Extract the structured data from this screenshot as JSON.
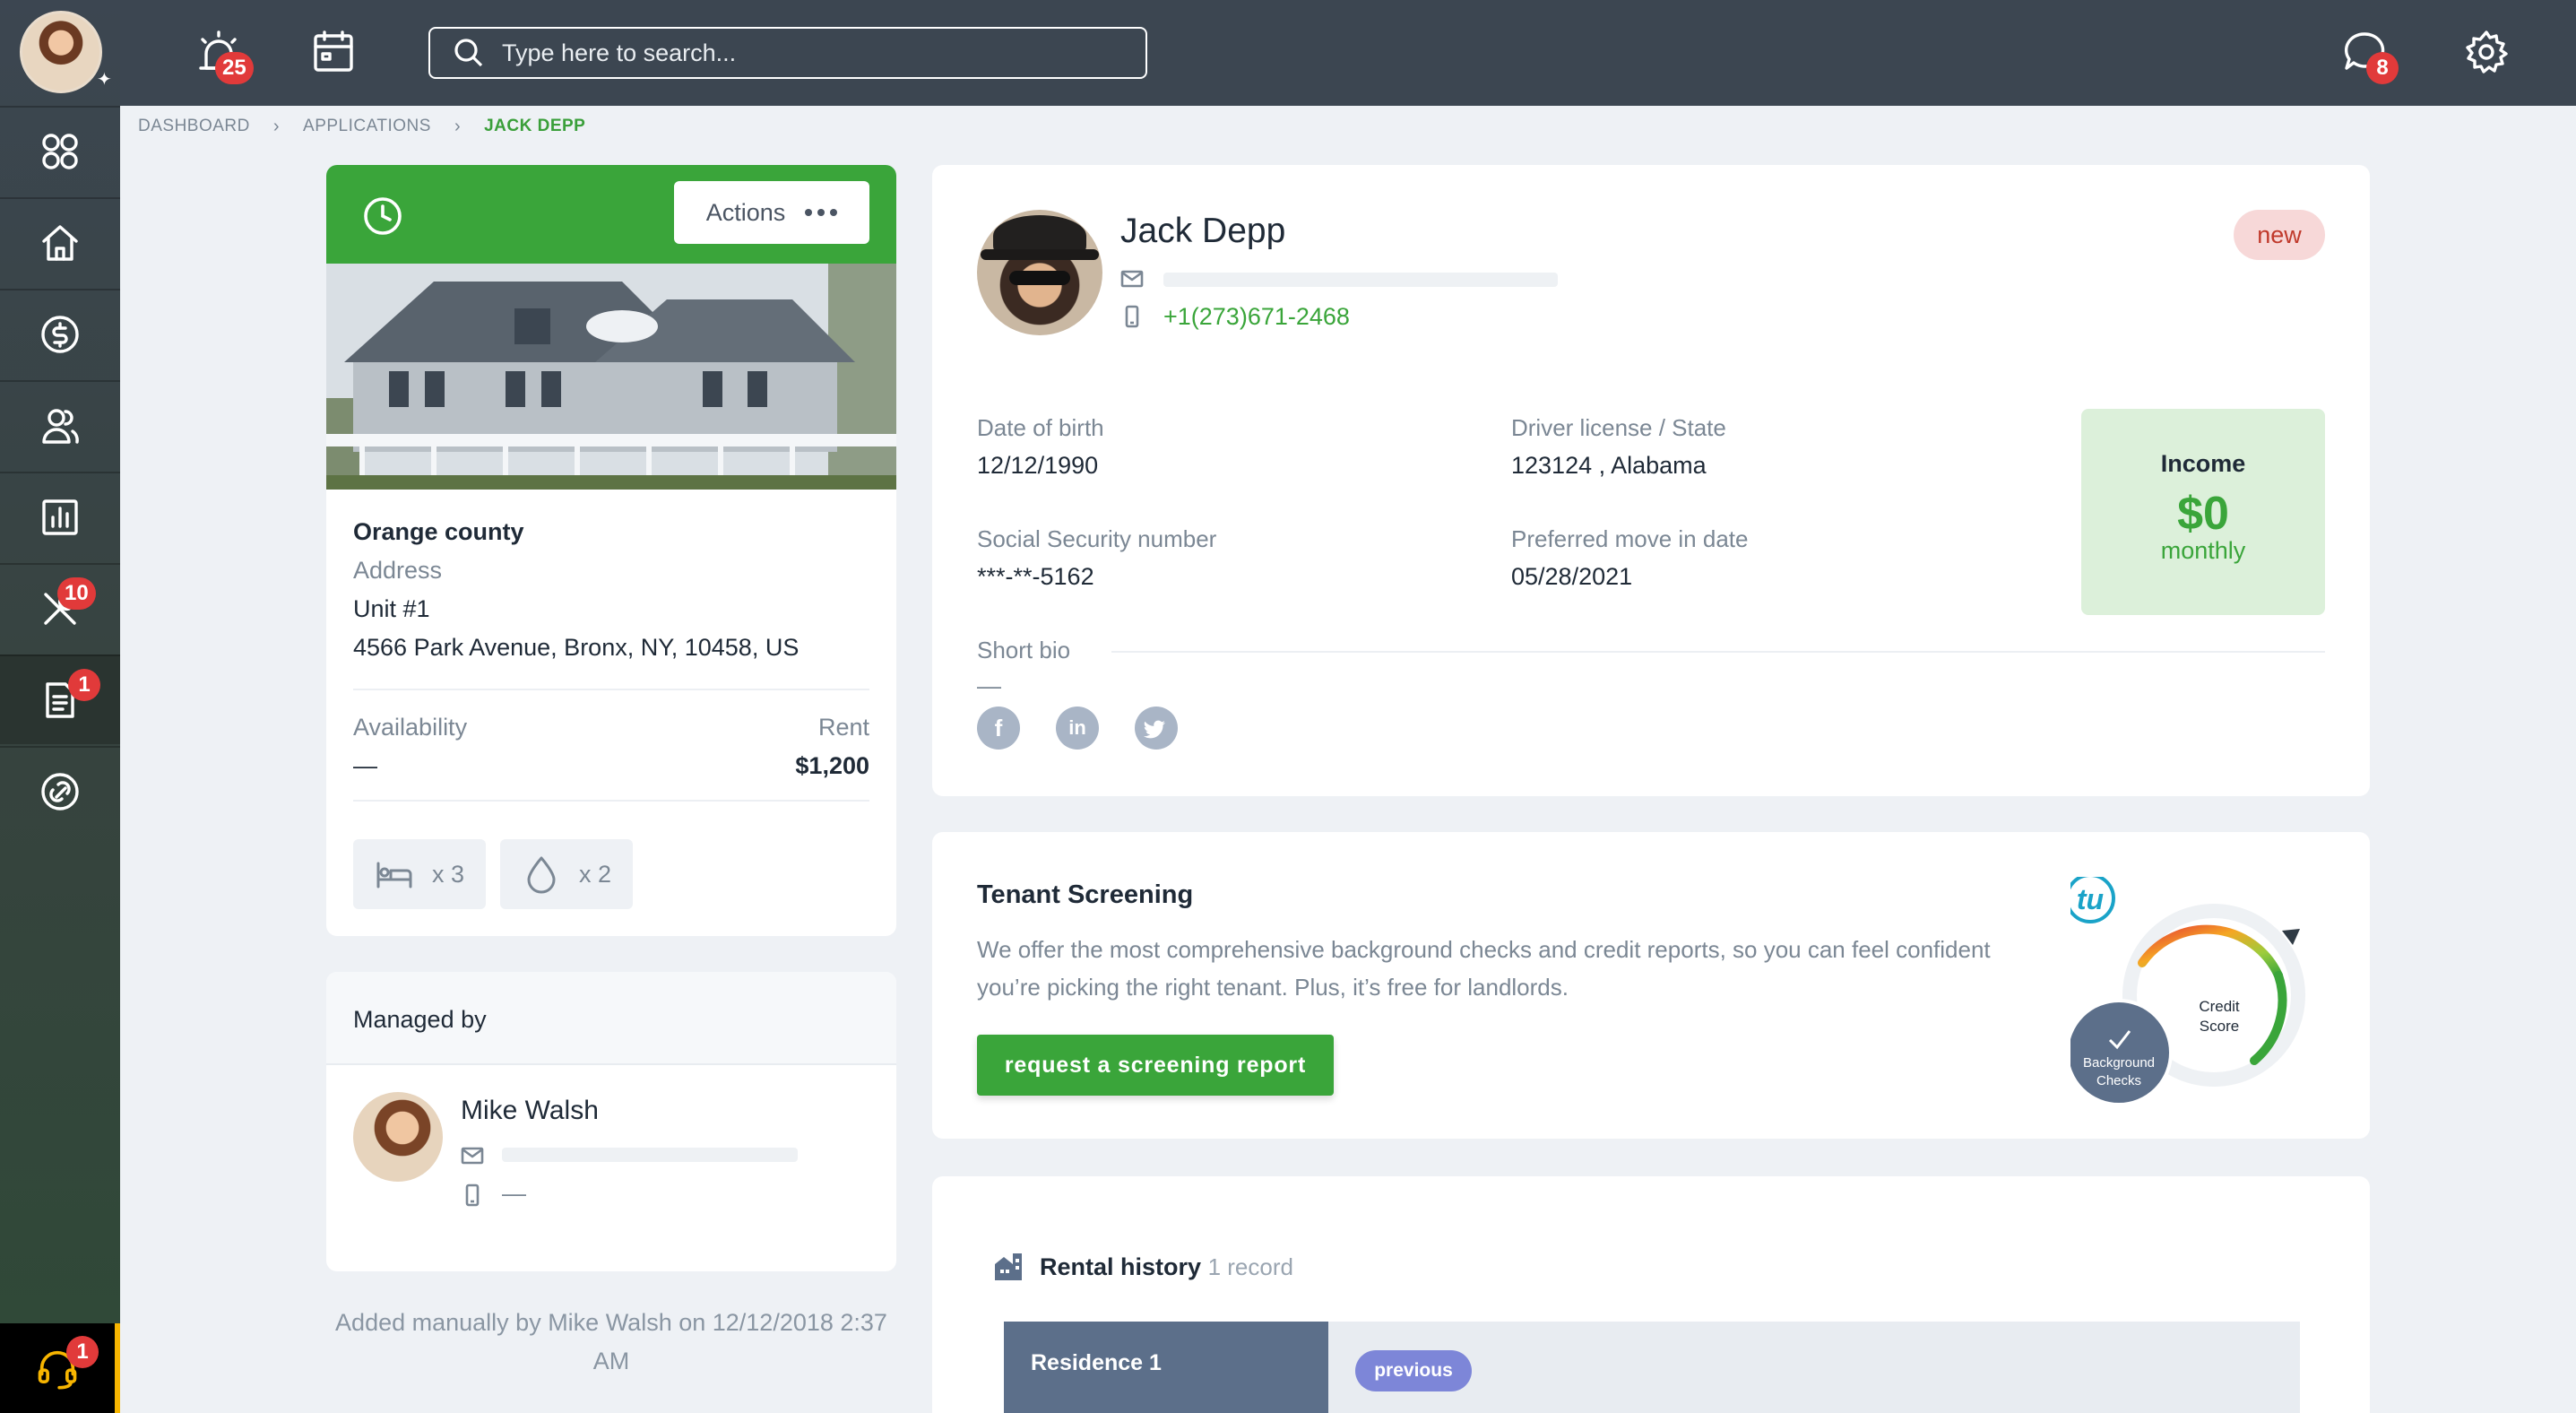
{
  "topbar": {
    "alarm_badge": "25",
    "search_placeholder": "Type here to search...",
    "chat_badge": "8"
  },
  "sidebar": {
    "items": [
      {
        "name": "apps",
        "icon": "grid-icon",
        "badge": ""
      },
      {
        "name": "home",
        "icon": "home-icon",
        "badge": ""
      },
      {
        "name": "payments",
        "icon": "dollar-icon",
        "badge": ""
      },
      {
        "name": "people",
        "icon": "users-icon",
        "badge": ""
      },
      {
        "name": "reports",
        "icon": "chart-icon",
        "badge": ""
      },
      {
        "name": "maintenance",
        "icon": "tools-icon",
        "badge": "10"
      },
      {
        "name": "applications",
        "icon": "document-icon",
        "badge": "1"
      },
      {
        "name": "links",
        "icon": "link-icon",
        "badge": ""
      }
    ],
    "support_badge": "1"
  },
  "breadcrumb": {
    "items": [
      "DASHBOARD",
      "APPLICATIONS"
    ],
    "current": "JACK DEPP"
  },
  "property": {
    "actions_label": "Actions",
    "name": "Orange county",
    "address_label": "Address",
    "unit": "Unit #1",
    "address": "4566 Park Avenue, Bronx, NY, 10458, US",
    "availability_label": "Availability",
    "availability_value": "—",
    "rent_label": "Rent",
    "rent_value": "$1,200",
    "beds": "x 3",
    "baths": "x 2"
  },
  "manager": {
    "heading": "Managed by",
    "name": "Mike Walsh",
    "phone": "—"
  },
  "added_note": "Added manually by Mike Walsh on 12/12/2018 2:37 AM",
  "applicant": {
    "name": "Jack Depp",
    "status": "new",
    "phone": "+1(273)671-2468",
    "dob_label": "Date of birth",
    "dob": "12/12/1990",
    "license_label": "Driver license / State",
    "license": "123124 , Alabama",
    "ssn_label": "Social Security number",
    "ssn": "***-**-5162",
    "move_label": "Preferred move in date",
    "move_date": "05/28/2021",
    "bio_label": "Short bio",
    "bio": "—",
    "income_label": "Income",
    "income_value": "$0",
    "income_period": "monthly"
  },
  "screening": {
    "title": "Tenant Screening",
    "description": "We offer the most comprehensive background checks and credit reports, so you can feel confident you’re picking the right tenant. Plus, it’s free for landlords.",
    "button": "request a screening report",
    "logo": "tu",
    "credit_label_1": "Credit",
    "credit_label_2": "Score",
    "bg_label_1": "Background",
    "bg_label_2": "Checks"
  },
  "rental_history": {
    "title": "Rental history",
    "count": "1 record",
    "residence": "Residence 1",
    "status": "previous"
  }
}
